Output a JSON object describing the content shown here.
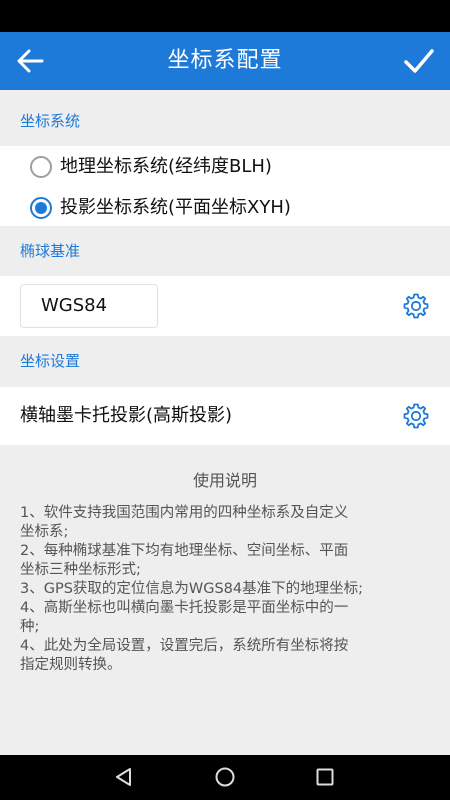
{
  "app_bar": {
    "title": "坐标系配置",
    "back_icon": "arrow-left-icon",
    "confirm_icon": "check-icon"
  },
  "colors": {
    "accent": "#1e7ad8",
    "background": "#eeeeee",
    "surface": "#ffffff"
  },
  "coord_system": {
    "header": "坐标系统",
    "options": [
      {
        "label": "地理坐标系统(经纬度BLH)",
        "checked": false
      },
      {
        "label": "投影坐标系统(平面坐标XYH)",
        "checked": true
      }
    ]
  },
  "ellipsoid": {
    "header": "椭球基准",
    "value": "WGS84",
    "settings_icon": "gear-icon"
  },
  "coord_settings": {
    "header": "坐标设置",
    "projection": "横轴墨卡托投影(高斯投影)",
    "settings_icon": "gear-icon"
  },
  "help": {
    "title": "使用说明",
    "lines": [
      "1、软件支持我国范围内常用的四种坐标系及自定义",
      "坐标系;",
      "2、每种椭球基准下均有地理坐标、空间坐标、平面",
      "坐标三种坐标形式;",
      "3、GPS获取的定位信息为WGS84基准下的地理坐标;",
      "4、高斯坐标也叫横向墨卡托投影是平面坐标中的一",
      "种;",
      "4、此处为全局设置，设置完后，系统所有坐标将按",
      "指定规则转换。"
    ]
  },
  "nav_bar": {
    "back_icon": "triangle-back-icon",
    "home_icon": "circle-home-icon",
    "recents_icon": "square-recents-icon"
  }
}
